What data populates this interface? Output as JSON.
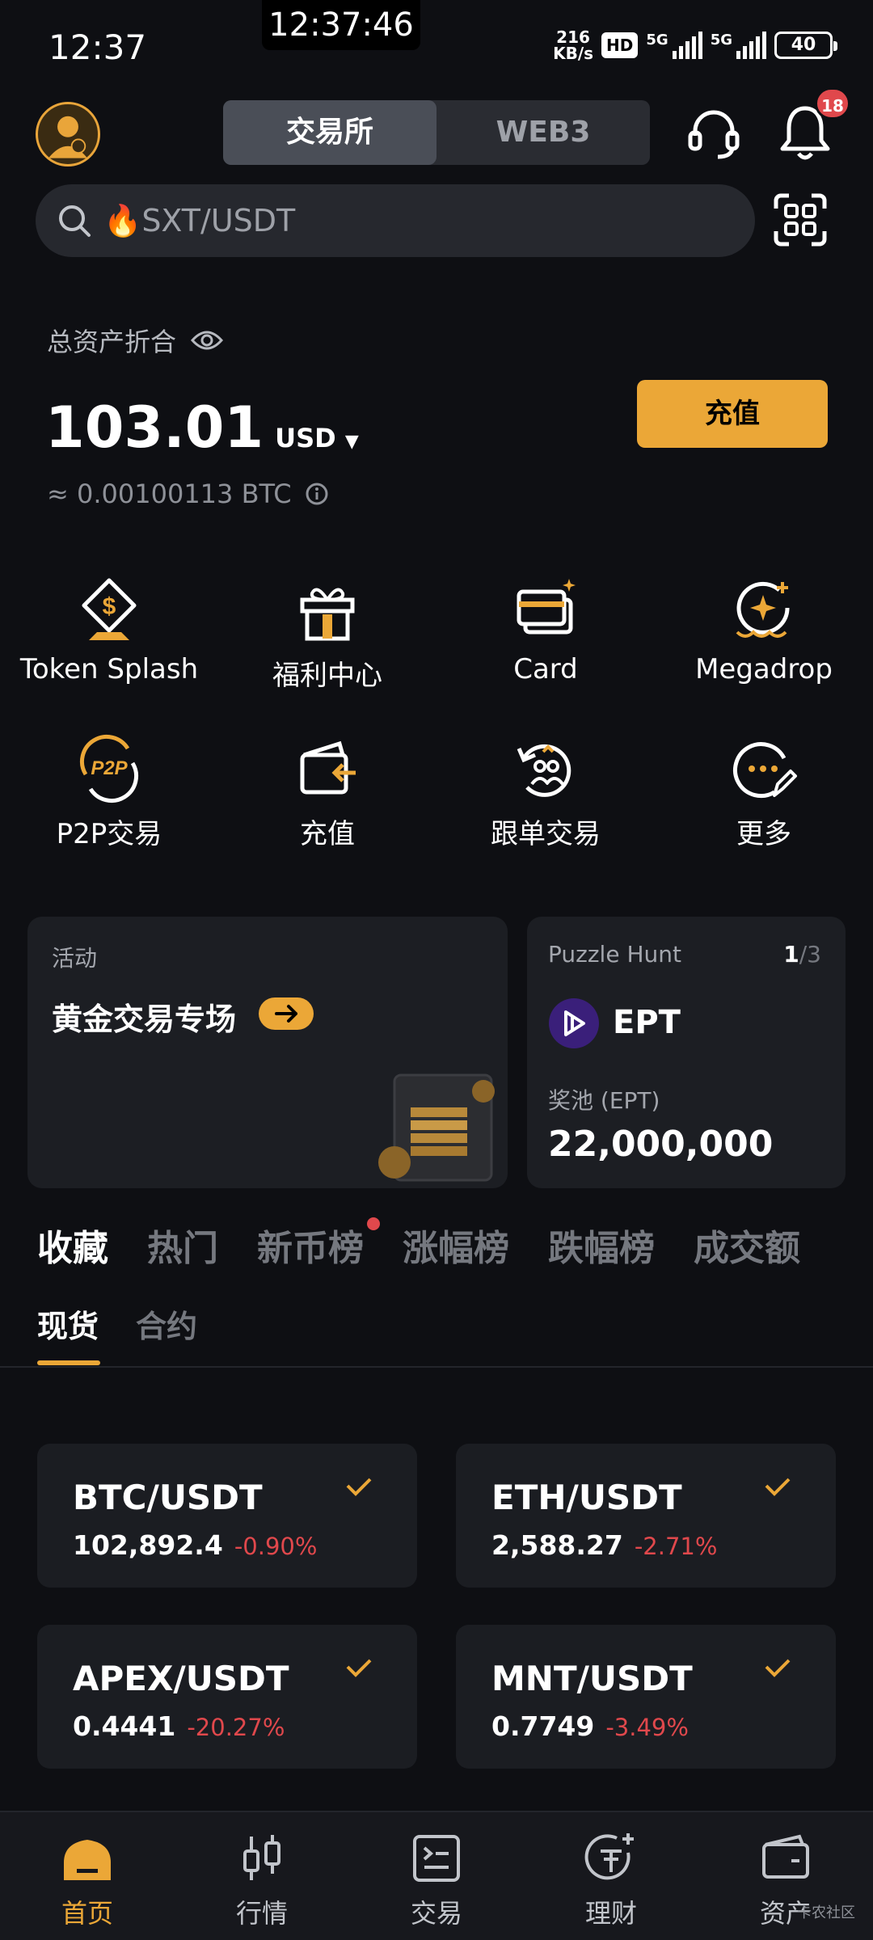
{
  "status_bar": {
    "time": "12:37",
    "clock_pill": "12:37:46",
    "net_speed_value": "216",
    "net_speed_unit": "KB/s",
    "hd_label": "HD",
    "sim1": "5G",
    "sim2": "5G",
    "battery": "40"
  },
  "header": {
    "tabs": [
      "交易所",
      "WEB3"
    ],
    "active_tab": "交易所",
    "notification_count": "18"
  },
  "search": {
    "placeholder": "🔥SXT/USDT"
  },
  "assets": {
    "label": "总资产折合",
    "value": "103.01",
    "currency": "USD",
    "btc_equiv": "≈ 0.00100113 BTC",
    "deposit_label": "充值"
  },
  "shortcuts": [
    {
      "label": "Token Splash",
      "icon": "token-splash-icon"
    },
    {
      "label": "福利中心",
      "icon": "gift-icon"
    },
    {
      "label": "Card",
      "icon": "card-icon"
    },
    {
      "label": "Megadrop",
      "icon": "megadrop-icon"
    },
    {
      "label": "P2P交易",
      "icon": "p2p-icon"
    },
    {
      "label": "充值",
      "icon": "deposit-icon"
    },
    {
      "label": "跟单交易",
      "icon": "copy-trade-icon"
    },
    {
      "label": "更多",
      "icon": "more-icon"
    }
  ],
  "promo": {
    "activity_label": "活动",
    "activity_title": "黄金交易专场",
    "puzzle_label": "Puzzle Hunt",
    "puzzle_page_current": "1",
    "puzzle_page_total": "/3",
    "token": "EPT",
    "pool_label": "奖池 (EPT)",
    "pool_value": "22,000,000"
  },
  "market_tabs": [
    "收藏",
    "热门",
    "新币榜",
    "涨幅榜",
    "跌幅榜",
    "成交额"
  ],
  "market_subtabs": [
    "现货",
    "合约"
  ],
  "favorites": [
    {
      "pair": "BTC/USDT",
      "price": "102,892.4",
      "change": "-0.90%"
    },
    {
      "pair": "ETH/USDT",
      "price": "2,588.27",
      "change": "-2.71%"
    },
    {
      "pair": "APEX/USDT",
      "price": "0.4441",
      "change": "-20.27%"
    },
    {
      "pair": "MNT/USDT",
      "price": "0.7749",
      "change": "-3.49%"
    }
  ],
  "bottom_nav": [
    {
      "label": "首页",
      "icon": "home-icon"
    },
    {
      "label": "行情",
      "icon": "market-icon"
    },
    {
      "label": "交易",
      "icon": "trade-icon"
    },
    {
      "label": "理财",
      "icon": "earn-icon"
    },
    {
      "label": "资产",
      "icon": "wallet-icon"
    }
  ],
  "watermark": "卡农社区",
  "colors": {
    "accent": "#eba737",
    "negative": "#e0484c",
    "background": "#0e0f13"
  }
}
